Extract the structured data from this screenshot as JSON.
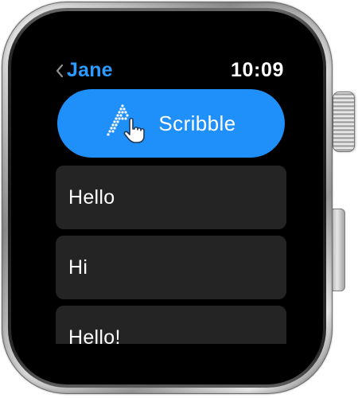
{
  "status_bar": {
    "back_label": "Jane",
    "back_icon": "chevron-left-icon",
    "time": "10:09"
  },
  "scribble": {
    "label": "Scribble",
    "icon": "scribble-hand-icon",
    "color": "#1f8ffa"
  },
  "replies": [
    {
      "label": "Hello"
    },
    {
      "label": "Hi"
    },
    {
      "label": "Hello!"
    }
  ],
  "colors": {
    "accent": "#2b9bff",
    "screen_background": "#000000",
    "reply_background": "#242424"
  }
}
